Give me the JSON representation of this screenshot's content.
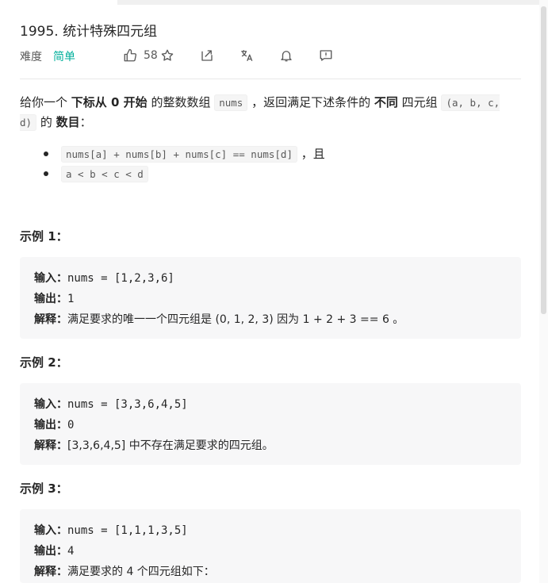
{
  "problem": {
    "title": "1995. 统计特殊四元组",
    "difficulty_label": "难度",
    "difficulty": "简单",
    "likes": "58"
  },
  "description": {
    "p1_a": "给你一个 ",
    "p1_b": "下标从 0 开始",
    "p1_c": " 的整数数组 ",
    "p1_code1": "nums",
    "p1_d": " ，返回满足下述条件的 ",
    "p1_e": "不同",
    "p1_f": " 四元组 ",
    "p1_code2": "(a, b, c, d)",
    "p1_g": " 的 ",
    "p1_h": "数目",
    "p1_i": "：",
    "bullet1_code": "nums[a] + nums[b] + nums[c] == nums[d]",
    "bullet1_suffix": " ，且",
    "bullet2_code": "a < b < c < d"
  },
  "examples": [
    {
      "title": "示例 1：",
      "input_label": "输入：",
      "input": "nums = [1,2,3,6]",
      "output_label": "输出：",
      "output": "1",
      "explain_label": "解释：",
      "explain": "满足要求的唯一一个四元组是 (0, 1, 2, 3) 因为 1 + 2 + 3 == 6 。"
    },
    {
      "title": "示例 2：",
      "input_label": "输入：",
      "input": "nums = [3,3,6,4,5]",
      "output_label": "输出：",
      "output": "0",
      "explain_label": "解释：",
      "explain": "[3,3,6,4,5] 中不存在满足要求的四元组。"
    },
    {
      "title": "示例 3：",
      "input_label": "输入：",
      "input": "nums = [1,1,1,3,5]",
      "output_label": "输出：",
      "output": "4",
      "explain_label": "解释：",
      "explain": "满足要求的 4 个四元组如下："
    }
  ],
  "icons": [
    "thumbs-up-icon",
    "star-icon",
    "share-icon",
    "translate-icon",
    "bell-icon",
    "feedback-icon"
  ],
  "colors": {
    "difficulty_easy": "#00af9b"
  }
}
